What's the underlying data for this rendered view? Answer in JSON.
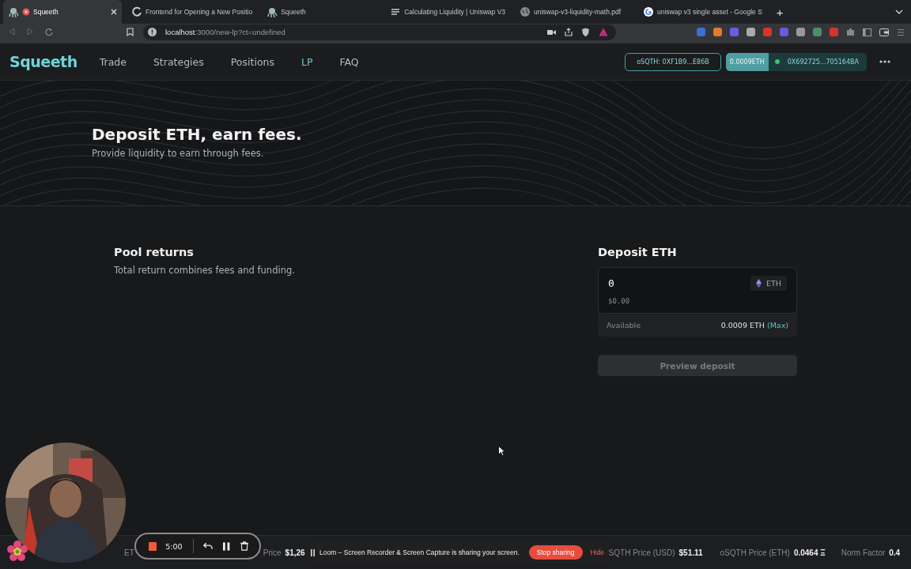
{
  "browser": {
    "tabs": [
      {
        "title": "Squeeth",
        "selected": true,
        "recording": true,
        "kind": "squid"
      },
      {
        "title": "Frontend for Opening a New Positio",
        "selected": false,
        "recording": false,
        "kind": "loader"
      },
      {
        "title": "Squeeth",
        "selected": false,
        "recording": false,
        "kind": "squid"
      },
      {
        "title": "Calculating Liquidity | Uniswap V3",
        "selected": false,
        "recording": false,
        "kind": "doc"
      },
      {
        "title": "uniswap-v3-liquidity-math.pdf",
        "selected": false,
        "recording": false,
        "kind": "globe"
      },
      {
        "title": "uniswap v3 single asset - Google S",
        "selected": false,
        "recording": false,
        "kind": "google"
      }
    ],
    "new_tab": "+",
    "url_host": "localhost",
    "url_path": ":3000/new-lp?ct=undefined"
  },
  "nav": {
    "logo": "Squeeth",
    "links": [
      {
        "label": "Trade",
        "selected": false
      },
      {
        "label": "Strategies",
        "selected": false
      },
      {
        "label": "Positions",
        "selected": false
      },
      {
        "label": "LP",
        "selected": true
      },
      {
        "label": "FAQ",
        "selected": false
      }
    ],
    "token_button": "oSQTH: 0XF1B9...E86B",
    "balance": "0.0009ETH",
    "wallet": "0X692725...705164BA",
    "wallet_connected": true
  },
  "hero": {
    "title": "Deposit ETH, earn fees.",
    "subtitle": "Provide liquidity to earn through fees."
  },
  "pool_returns": {
    "title": "Pool returns",
    "subtitle": "Total return combines fees and funding."
  },
  "deposit": {
    "title": "Deposit ETH",
    "value": "0",
    "unit": "ETH",
    "usd": "$0.00",
    "available_label": "Available",
    "available": "0.0009 ETH",
    "max": "(Max)",
    "button": "Preview deposit",
    "disabled": true
  },
  "footer_stats": [
    {
      "label": "ET"
    },
    {
      "label": "Price",
      "value": "$1,26"
    },
    {
      "label": "SQTH Price (USD)",
      "value": "$51.11"
    },
    {
      "label": "oSQTH Price (ETH)",
      "value": "0.0464 Ξ"
    },
    {
      "label": "Norm Factor",
      "value": "0.4"
    }
  ],
  "recorder": {
    "time": "5:00"
  },
  "sharing_bar": {
    "message": "Loom – Screen Recorder & Screen Capture is sharing your screen.",
    "stop": "Stop sharing",
    "hide": "Hide"
  }
}
